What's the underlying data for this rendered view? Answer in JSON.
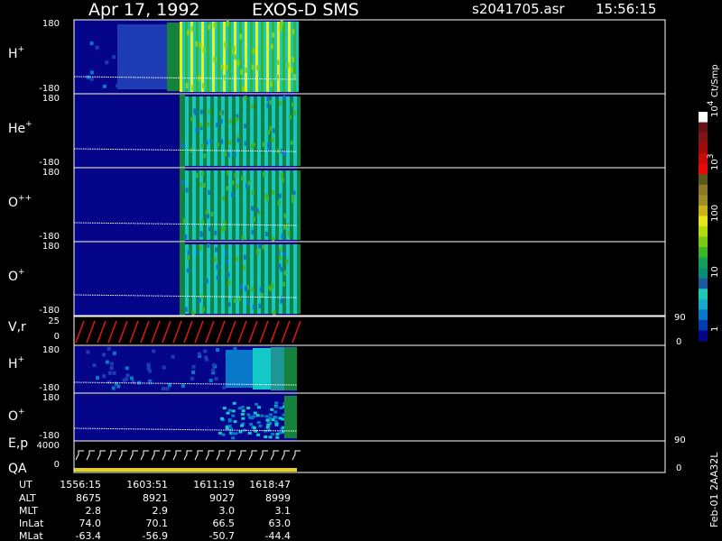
{
  "header": {
    "date": "Apr 17, 1992",
    "instrument": "EXOS-D SMS",
    "file": "s2041705.asr",
    "start_time": "15:56:15"
  },
  "colorbar": {
    "unit_label": "Ct/Smp",
    "tick_labels": [
      "1",
      "10",
      "100",
      "10",
      "10"
    ],
    "tick_exponents": [
      "",
      "",
      "",
      "3",
      "4"
    ],
    "colors": [
      "#05058a",
      "#003caf",
      "#0a78c8",
      "#14aac8",
      "#1ec8b4",
      "#1e5aa0",
      "#0a8c78",
      "#14a05a",
      "#3cb428",
      "#78c814",
      "#b4dc0a",
      "#e6e61e",
      "#c8b414",
      "#a08c28",
      "#8c7828",
      "#5a5a1e",
      "#e60a0a",
      "#c80a0a",
      "#a00a0a",
      "#821414",
      "#641414",
      "#ffffff"
    ]
  },
  "panels": [
    {
      "id": "h-plus",
      "label": "H",
      "sup": "+",
      "ytop": "180",
      "ybot": "-180",
      "right_top": "",
      "right_bot": ""
    },
    {
      "id": "he-plus",
      "label": "He",
      "sup": "+",
      "ytop": "180",
      "ybot": "-180",
      "right_top": "",
      "right_bot": ""
    },
    {
      "id": "o-plus-plus",
      "label": "O",
      "sup": "++",
      "ytop": "180",
      "ybot": "-180",
      "right_top": "",
      "right_bot": ""
    },
    {
      "id": "o-plus",
      "label": "O",
      "sup": "+",
      "ytop": "180",
      "ybot": "-180",
      "right_top": "",
      "right_bot": ""
    },
    {
      "id": "vr",
      "label": "V,r",
      "sup": "",
      "ytop": "25",
      "ybot": "0",
      "right_top": "90",
      "right_bot": "0"
    },
    {
      "id": "h-plus-2",
      "label": "H",
      "sup": "+",
      "ytop": "180",
      "ybot": "-180",
      "right_top": "",
      "right_bot": ""
    },
    {
      "id": "o-plus-2",
      "label": "O",
      "sup": "+",
      "ytop": "180",
      "ybot": "-180",
      "right_top": "",
      "right_bot": ""
    },
    {
      "id": "ep-qa",
      "label": "E,p",
      "label2": "QA",
      "sup": "",
      "ytop": "4000",
      "ybot": "0",
      "right_top": "90",
      "right_bot": "0"
    }
  ],
  "footer": {
    "row_labels": [
      "UT",
      "ALT",
      "MLT",
      "InLat",
      "MLat"
    ],
    "columns": [
      [
        "1556:15",
        "8675",
        "2.8",
        "74.0",
        "-63.4"
      ],
      [
        "1603:51",
        "8921",
        "2.9",
        "70.1",
        "-56.9"
      ],
      [
        "1611:19",
        "9027",
        "3.0",
        "66.5",
        "-50.7"
      ],
      [
        "1618:47",
        "8999",
        "3.1",
        "63.0",
        "-44.4"
      ]
    ],
    "side_note": "Feb-01 2AA32L"
  },
  "chart_data": {
    "type": "heatmap",
    "title": "Apr 17, 1992   EXOS-D SMS",
    "xlabel": "UT",
    "x": [
      "1556:15",
      "1603:51",
      "1611:19",
      "1618:47"
    ],
    "panels": [
      "H+",
      "He+",
      "O++",
      "O+",
      "V,r",
      "H+",
      "O+",
      "E,p / QA"
    ],
    "colorbar_unit": "Ct/Smp",
    "colorbar_range": [
      1,
      10000
    ],
    "colorbar_scale": "log",
    "ion_panel_ylim": [
      -180,
      180
    ]
  }
}
